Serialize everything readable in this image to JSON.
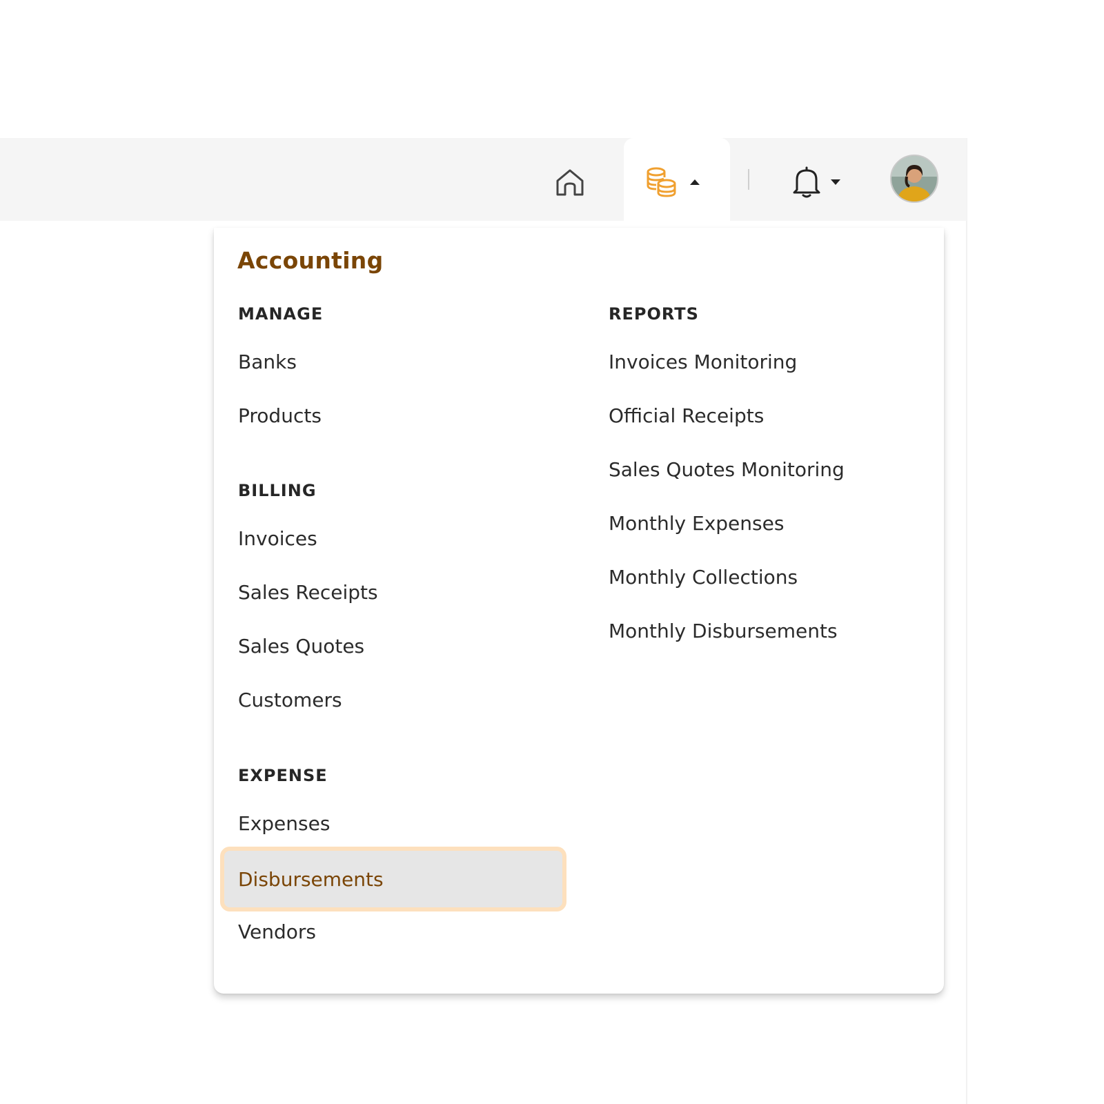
{
  "colors": {
    "brand": "#7a4506",
    "accent_icon": "#f0a030",
    "active_bg": "#e6e6e6",
    "active_border": "#fde0bd",
    "topbar_bg": "#f5f5f5"
  },
  "topbar": {
    "icons": [
      "home-icon",
      "coins-icon",
      "bell-icon",
      "user-avatar"
    ]
  },
  "dropdown": {
    "title": "Accounting",
    "manage": {
      "heading": "MANAGE",
      "items": [
        "Banks",
        "Products"
      ]
    },
    "billing": {
      "heading": "BILLING",
      "items": [
        "Invoices",
        "Sales Receipts",
        "Sales Quotes",
        "Customers"
      ]
    },
    "expense": {
      "heading": "EXPENSE",
      "items": [
        "Expenses",
        "Disbursements",
        "Vendors"
      ],
      "active": "Disbursements"
    },
    "reports": {
      "heading": "REPORTS",
      "items": [
        "Invoices Monitoring",
        "Official Receipts",
        "Sales Quotes Monitoring",
        "Monthly Expenses",
        "Monthly Collections",
        "Monthly Disbursements"
      ]
    }
  }
}
